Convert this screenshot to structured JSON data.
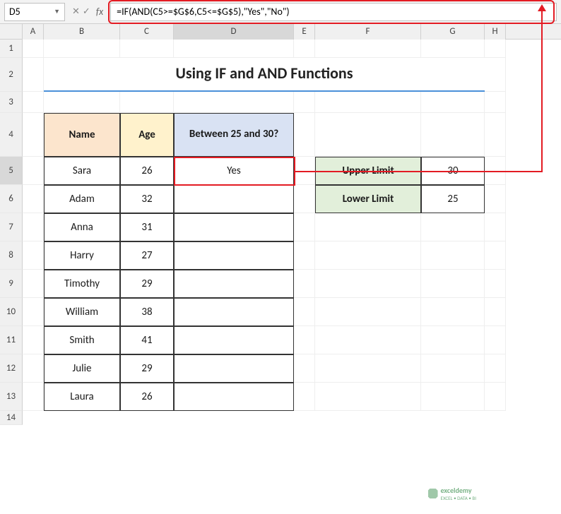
{
  "nameBox": "D5",
  "formula": "=IF(AND(C5>=$G$6,C5<=$G$5),\"Yes\",\"No\")",
  "columns": [
    "A",
    "B",
    "C",
    "D",
    "E",
    "F",
    "G",
    "H"
  ],
  "rows": [
    "1",
    "2",
    "3",
    "4",
    "5",
    "6",
    "7",
    "8",
    "9",
    "10",
    "11",
    "12",
    "13",
    "14"
  ],
  "title": "Using IF and AND Functions",
  "headers": {
    "name": "Name",
    "age": "Age",
    "between": "Between 25 and 30?"
  },
  "limits": {
    "upper_label": "Upper Limit",
    "upper_value": "30",
    "lower_label": "Lower Limit",
    "lower_value": "25"
  },
  "data": [
    {
      "name": "Sara",
      "age": "26",
      "result": "Yes"
    },
    {
      "name": "Adam",
      "age": "32",
      "result": ""
    },
    {
      "name": "Anna",
      "age": "31",
      "result": ""
    },
    {
      "name": "Harry",
      "age": "27",
      "result": ""
    },
    {
      "name": "Timothy",
      "age": "29",
      "result": ""
    },
    {
      "name": "William",
      "age": "38",
      "result": ""
    },
    {
      "name": "Smith",
      "age": "41",
      "result": ""
    },
    {
      "name": "Julie",
      "age": "29",
      "result": ""
    },
    {
      "name": "Laura",
      "age": "26",
      "result": ""
    }
  ],
  "watermark": {
    "brand": "exceldemy",
    "tag": "EXCEL • DATA • BI"
  }
}
